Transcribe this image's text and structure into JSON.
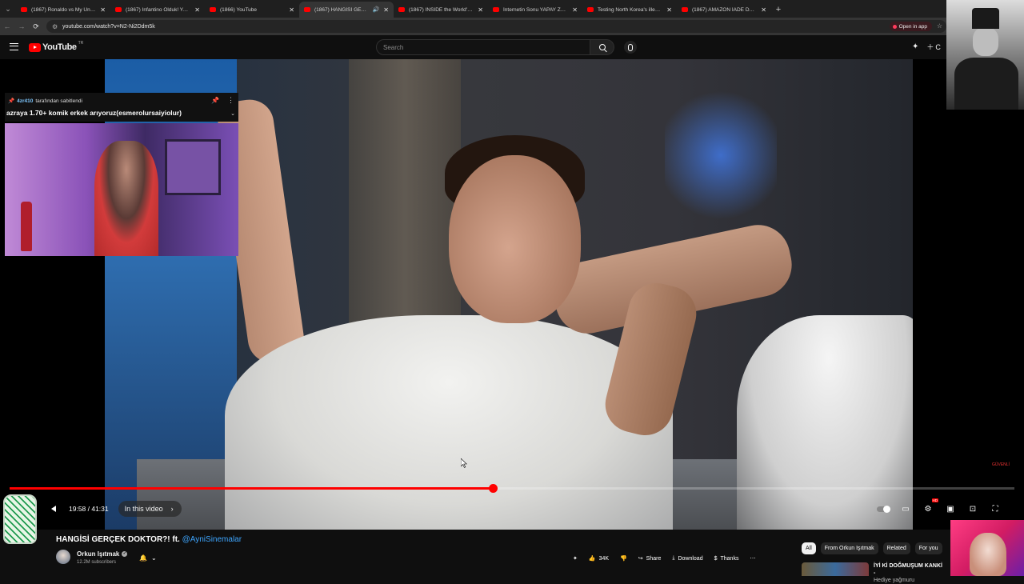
{
  "browser": {
    "tabs": [
      {
        "title": "(1867) Ronaldo vs My Unbeaten"
      },
      {
        "title": "(1867) Infantino Olduk! Yan Ya"
      },
      {
        "title": "(1866) YouTube"
      },
      {
        "title": "(1867) HANGİSİ GERÇEK D...",
        "active": true,
        "audio": true
      },
      {
        "title": "(1867) INSIDE the World's Mos"
      },
      {
        "title": "İnternetin Sonu YAPAY ZEKA Ol"
      },
      {
        "title": "Testing North Korea's illegal sm"
      },
      {
        "title": "(1867) AMAZON İADE DEPOSU"
      }
    ],
    "url": "youtube.com/watch?v=N2-Ni2Ddm5k",
    "open_in_app": "Open in app"
  },
  "masthead": {
    "logo_text": "YouTube",
    "country_code": "TR",
    "search_placeholder": "Search",
    "create_label": "C"
  },
  "overlay": {
    "pinned_by": "4zr410",
    "pinned_suffix": "tarafından sabitlendi",
    "pinned_message": "azraya 1.70+ komik erkek arıyoruz(esmerolursaiyiolur)"
  },
  "player": {
    "time_current": "19:58",
    "time_total": "41:31",
    "time_display": "19:58 / 41:31",
    "progress": 0.481,
    "chapter_label": "In this video",
    "hd_badge": "HD"
  },
  "video_info": {
    "title": "HANGİSİ GERÇEK DOKTOR?! ft.",
    "mention": "@AyniSinemalar",
    "channel": "Orkun Işıtmak",
    "subscribers": "12.2M subscribers",
    "likes": "34K",
    "share": "Share",
    "download": "Download",
    "thanks": "Thanks"
  },
  "chips": [
    "All",
    "From Orkun Işıtmak",
    "Related",
    "For you"
  ],
  "recommendation": {
    "title": "İYİ Kİ DOĞMUŞUM KANKİ -",
    "subtitle": "Hediye yağmuru"
  },
  "corner_badge": "GÜVENLİ"
}
